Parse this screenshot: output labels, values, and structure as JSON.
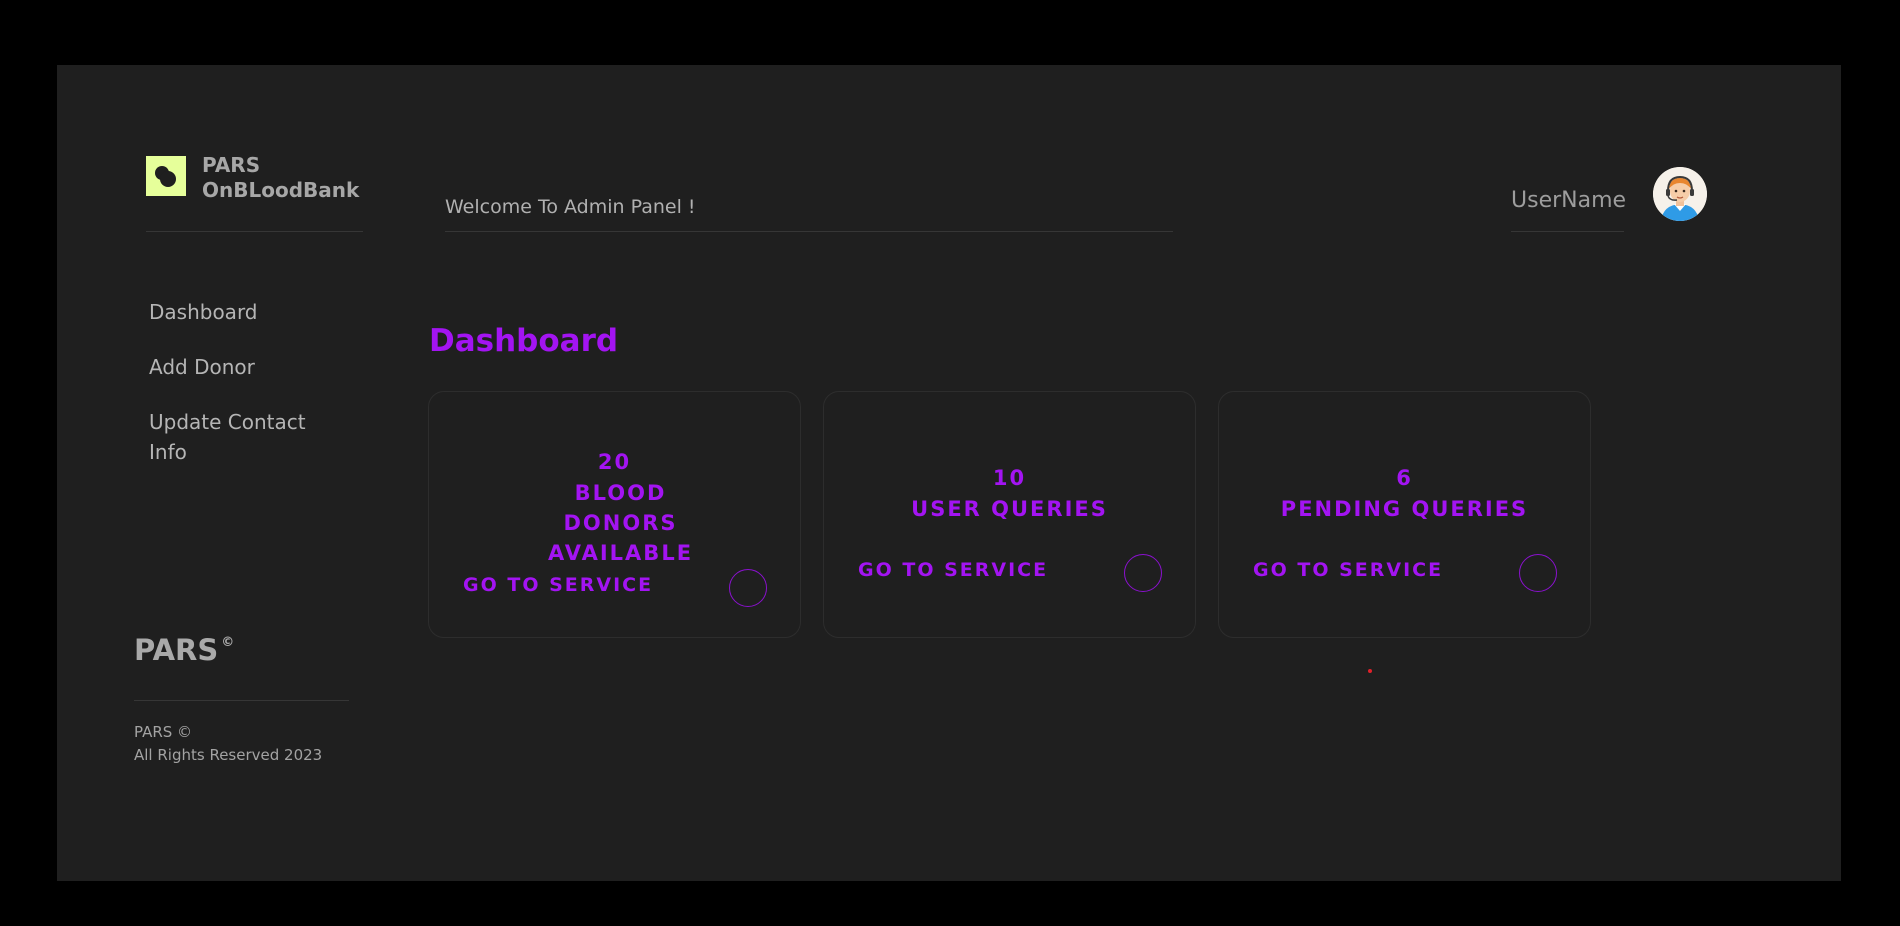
{
  "app": {
    "logo_line1": "PARS",
    "logo_line2": "OnBLoodBank"
  },
  "header": {
    "welcome": "Welcome To Admin Panel !",
    "username": "UserName"
  },
  "sidebar": {
    "items": [
      {
        "label": "Dashboard"
      },
      {
        "label": "Add Donor"
      },
      {
        "label": "Update Contact Info"
      }
    ]
  },
  "footer": {
    "brand": "PARS",
    "brand_mark": "©",
    "line1": "PARS ©",
    "line2": "All Rights Reserved 2023"
  },
  "main": {
    "title": "Dashboard",
    "cards": [
      {
        "value": "20",
        "title": "BLOOD DONORS AVAILABLE",
        "link": "GO TO SERVICE"
      },
      {
        "value": "10",
        "title": "USER QUERIES",
        "link": "GO TO SERVICE"
      },
      {
        "value": "6",
        "title": "PENDING QUERIES",
        "link": "GO TO SERVICE"
      }
    ]
  },
  "colors": {
    "background": "#1f1f1f",
    "accent": "#a314f2",
    "logo": "#e6ff9a"
  }
}
